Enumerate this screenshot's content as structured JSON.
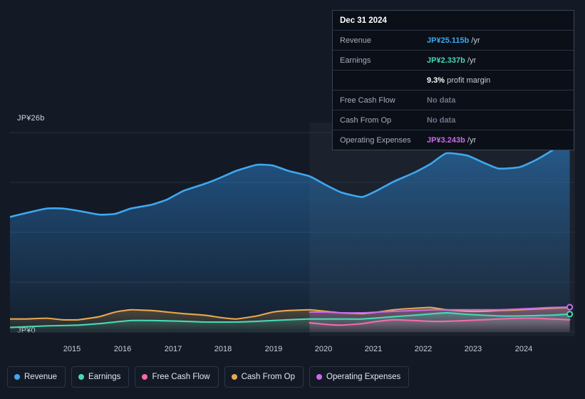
{
  "chart_data": {
    "type": "area",
    "title": "",
    "xlabel": "",
    "ylabel": "",
    "ylim": [
      0,
      26
    ],
    "y_unit": "JP¥b",
    "y_axis_labels": {
      "top": "JP¥26b",
      "bottom": "JP¥0"
    },
    "grid": true,
    "legend_position": "bottom-left",
    "x_tick_labels": [
      "2015",
      "2016",
      "2017",
      "2018",
      "2019",
      "2020",
      "2021",
      "2022",
      "2023",
      "2024"
    ],
    "x_tick_positions": [
      101,
      172,
      243,
      313,
      384,
      454,
      524,
      594,
      664,
      735
    ],
    "series": [
      {
        "name": "Revenue",
        "color": "#3ea8f0",
        "x": [
          2014.3,
          2014.6,
          2015.0,
          2015.3,
          2015.6,
          2016.0,
          2016.3,
          2016.6,
          2017.0,
          2017.3,
          2017.6,
          2018.0,
          2018.3,
          2018.6,
          2019.0,
          2019.3,
          2019.6,
          2020.0,
          2020.3,
          2020.6,
          2021.0,
          2021.3,
          2021.6,
          2022.0,
          2022.3,
          2022.6,
          2023.0,
          2023.3,
          2023.6,
          2024.0,
          2024.3,
          2024.6,
          2024.95
        ],
        "values": [
          15.0,
          15.5,
          16.1,
          16.1,
          15.8,
          15.3,
          15.4,
          16.1,
          16.6,
          17.3,
          18.4,
          19.3,
          20.1,
          21.0,
          21.8,
          21.7,
          21.0,
          20.3,
          19.2,
          18.2,
          17.6,
          18.5,
          19.6,
          20.8,
          21.9,
          23.3,
          23.0,
          22.1,
          21.3,
          21.5,
          22.4,
          23.6,
          25.115
        ]
      },
      {
        "name": "Earnings",
        "color": "#46d9b8",
        "x": [
          2014.3,
          2015.0,
          2015.6,
          2016.0,
          2016.6,
          2017.0,
          2017.6,
          2018.0,
          2018.6,
          2019.0,
          2019.6,
          2020.0,
          2020.6,
          2021.0,
          2021.6,
          2022.0,
          2022.6,
          2023.0,
          2023.6,
          2024.0,
          2024.6,
          2024.95
        ],
        "values": [
          0.6,
          0.8,
          0.9,
          1.1,
          1.5,
          1.5,
          1.4,
          1.3,
          1.3,
          1.4,
          1.6,
          1.7,
          1.7,
          1.7,
          2.0,
          2.2,
          2.5,
          2.3,
          2.1,
          2.1,
          2.2,
          2.337
        ]
      },
      {
        "name": "Free Cash Flow",
        "color": "#f06ca8",
        "x": [
          2020.0,
          2020.3,
          2020.6,
          2021.0,
          2021.3,
          2021.6,
          2022.0,
          2022.3,
          2022.6,
          2023.0,
          2023.3,
          2023.6,
          2024.0,
          2024.3,
          2024.6,
          2024.95
        ],
        "values": [
          1.2,
          1.0,
          0.9,
          1.1,
          1.4,
          1.6,
          1.5,
          1.4,
          1.4,
          1.5,
          1.6,
          1.7,
          1.8,
          1.8,
          1.7,
          1.6
        ]
      },
      {
        "name": "Cash From Op",
        "color": "#e8a84e",
        "x": [
          2014.3,
          2014.6,
          2015.0,
          2015.3,
          2015.6,
          2016.0,
          2016.3,
          2016.6,
          2017.0,
          2017.3,
          2017.6,
          2018.0,
          2018.3,
          2018.6,
          2019.0,
          2019.3,
          2019.6,
          2020.0,
          2020.3,
          2020.6,
          2021.0,
          2021.3,
          2021.6,
          2022.0,
          2022.3,
          2022.6,
          2023.0,
          2023.3,
          2023.6,
          2024.0,
          2024.3,
          2024.6,
          2024.95
        ],
        "values": [
          1.7,
          1.7,
          1.8,
          1.6,
          1.6,
          2.0,
          2.6,
          2.9,
          2.8,
          2.6,
          2.4,
          2.2,
          1.9,
          1.7,
          2.1,
          2.6,
          2.8,
          2.9,
          2.7,
          2.5,
          2.4,
          2.6,
          2.9,
          3.1,
          3.2,
          2.9,
          2.7,
          2.7,
          2.8,
          2.9,
          3.0,
          3.1,
          3.2
        ]
      },
      {
        "name": "Operating Expenses",
        "color": "#c96ce8",
        "x": [
          2020.0,
          2020.3,
          2020.6,
          2021.0,
          2021.3,
          2021.6,
          2022.0,
          2022.3,
          2022.6,
          2023.0,
          2023.3,
          2023.6,
          2024.0,
          2024.3,
          2024.6,
          2024.95
        ],
        "values": [
          2.6,
          2.6,
          2.5,
          2.5,
          2.6,
          2.7,
          2.8,
          2.9,
          2.9,
          2.9,
          2.9,
          2.9,
          3.0,
          3.1,
          3.2,
          3.243
        ]
      }
    ],
    "highlight": {
      "x": 2020.0,
      "label": "2020"
    }
  },
  "tooltip": {
    "title": "Dec 31 2024",
    "rows": [
      {
        "key": "Revenue",
        "value": "JP¥25.115b",
        "unit": "/yr",
        "color": "rev",
        "nodata": false
      },
      {
        "key": "Earnings",
        "value": "JP¥2.337b",
        "unit": "/yr",
        "color": "earn",
        "nodata": false
      },
      {
        "key": "",
        "value": "9.3%",
        "unit": "profit margin",
        "color": "white",
        "nodata": false,
        "sub": true
      },
      {
        "key": "Free Cash Flow",
        "value": "No data",
        "unit": "",
        "color": "nodata",
        "nodata": true
      },
      {
        "key": "Cash From Op",
        "value": "No data",
        "unit": "",
        "color": "nodata",
        "nodata": true
      },
      {
        "key": "Operating Expenses",
        "value": "JP¥3.243b",
        "unit": "/yr",
        "color": "opex",
        "nodata": false
      }
    ]
  },
  "legend": {
    "items": [
      {
        "label": "Revenue",
        "color": "#3ea8f0"
      },
      {
        "label": "Earnings",
        "color": "#46d9b8"
      },
      {
        "label": "Free Cash Flow",
        "color": "#f06ca8"
      },
      {
        "label": "Cash From Op",
        "color": "#e8a84e"
      },
      {
        "label": "Operating Expenses",
        "color": "#c96ce8"
      }
    ]
  }
}
